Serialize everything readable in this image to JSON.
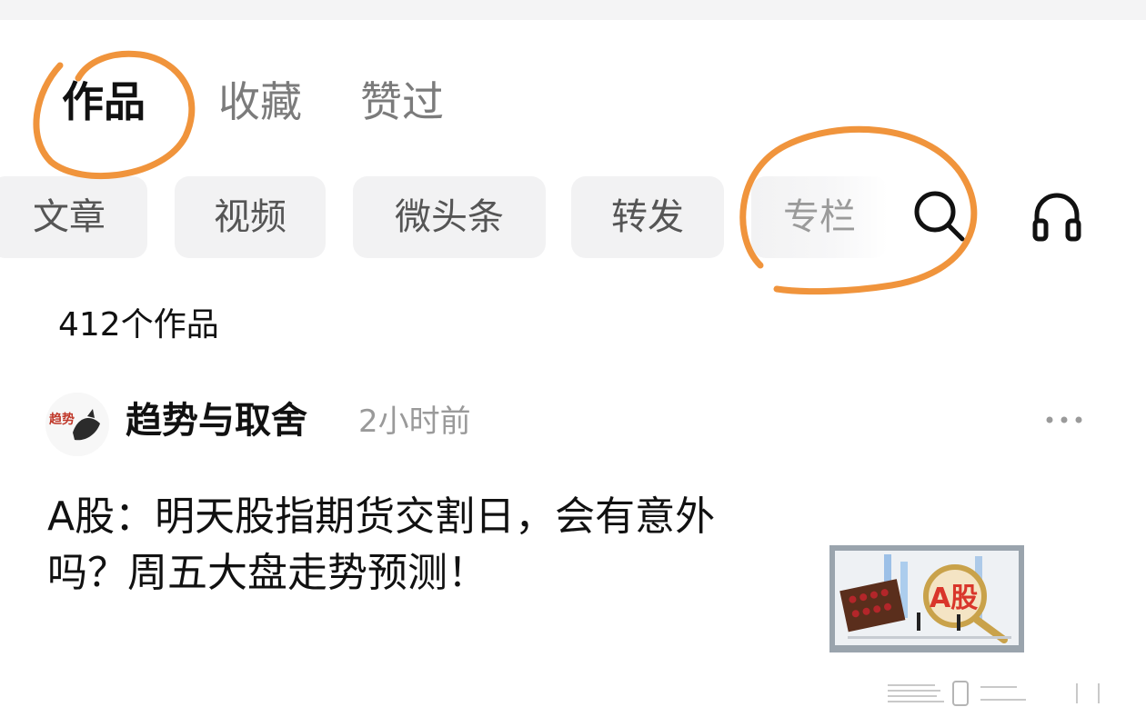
{
  "profile_tabs": [
    {
      "label": "作品",
      "active": true
    },
    {
      "label": "收藏",
      "active": false
    },
    {
      "label": "赞过",
      "active": false
    }
  ],
  "filter_chips": [
    {
      "label": "文章"
    },
    {
      "label": "视频"
    },
    {
      "label": "微头条"
    },
    {
      "label": "转发"
    },
    {
      "label": "专栏"
    }
  ],
  "toolbar_icons": {
    "search": "search-icon",
    "listen": "headphones-icon"
  },
  "works_count": "412个作品",
  "post": {
    "author": "趋势与取舍",
    "avatar_text": "趋势",
    "time": "2小时前",
    "title": "A股：明天股指期货交割日，会有意外吗？周五大盘走势预测！",
    "thumbnail_text": "A股"
  },
  "colors": {
    "annotation": "#f0943c",
    "chip_bg": "#f2f2f3",
    "muted_text": "#9a9a9a",
    "thumbnail_red": "#d9362b"
  }
}
